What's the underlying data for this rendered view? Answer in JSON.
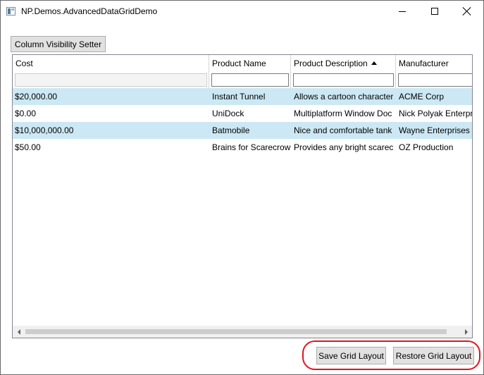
{
  "window": {
    "title": "NP.Demos.AdvancedDataGridDemo",
    "app_icon": "window-app-icon",
    "caption_icons": [
      "minimize-icon",
      "maximize-icon",
      "close-icon"
    ]
  },
  "toolbar": {
    "column_visibility_label": "Column Visibility Setter"
  },
  "grid": {
    "columns": [
      "Cost",
      "Product Name",
      "Product Description",
      "Manufacturer"
    ],
    "sorted_column": "Product Description",
    "sort_direction": "ascending",
    "filters": [
      "",
      "",
      "",
      ""
    ],
    "rows": [
      {
        "cost": "$20,000.00",
        "name": "Instant Tunnel",
        "description": "Allows a cartoon character",
        "manufacturer": "ACME Corp",
        "selected": true
      },
      {
        "cost": "$0.00",
        "name": "UniDock",
        "description": "Multiplatform Window Doc",
        "manufacturer": "Nick Polyak Enterpri",
        "selected": false
      },
      {
        "cost": "$10,000,000.00",
        "name": "Batmobile",
        "description": "Nice and comfortable tank",
        "manufacturer": "Wayne Enterprises",
        "selected": true
      },
      {
        "cost": "$50.00",
        "name": "Brains for Scarecrow",
        "description": "Provides any bright scarecr",
        "manufacturer": "OZ Production",
        "selected": false
      }
    ]
  },
  "footer": {
    "save_label": "Save Grid Layout",
    "restore_label": "Restore Grid Layout"
  },
  "colors": {
    "selected_row": "#cce8f4",
    "highlight": "#e0151d",
    "button_face": "#e1e1e1"
  }
}
